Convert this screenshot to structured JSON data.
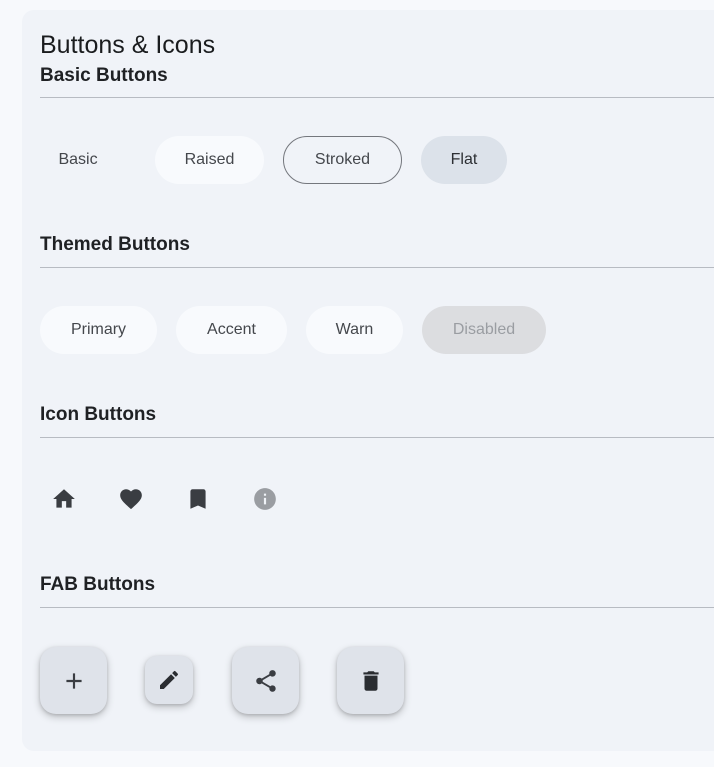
{
  "page": {
    "title": "Buttons & Icons"
  },
  "sections": {
    "basic": {
      "title": "Basic Buttons",
      "buttons": [
        "Basic",
        "Raised",
        "Stroked",
        "Flat"
      ]
    },
    "themed": {
      "title": "Themed Buttons",
      "buttons": [
        "Primary",
        "Accent",
        "Warn",
        "Disabled"
      ]
    },
    "icon": {
      "title": "Icon Buttons",
      "icons": [
        "home-icon",
        "heart-icon",
        "bookmark-icon",
        "info-icon"
      ]
    },
    "fab": {
      "title": "FAB Buttons",
      "icons": [
        "add-icon",
        "edit-icon",
        "share-icon",
        "delete-icon"
      ]
    }
  },
  "colors": {
    "page_background": "#f7f9fc",
    "card_background": "#f0f3f8",
    "icon_dark": "#3a3d42",
    "icon_disabled": "#9a9da2",
    "fab_background": "#dfe3ea",
    "disabled_button": "#dcdde0"
  }
}
